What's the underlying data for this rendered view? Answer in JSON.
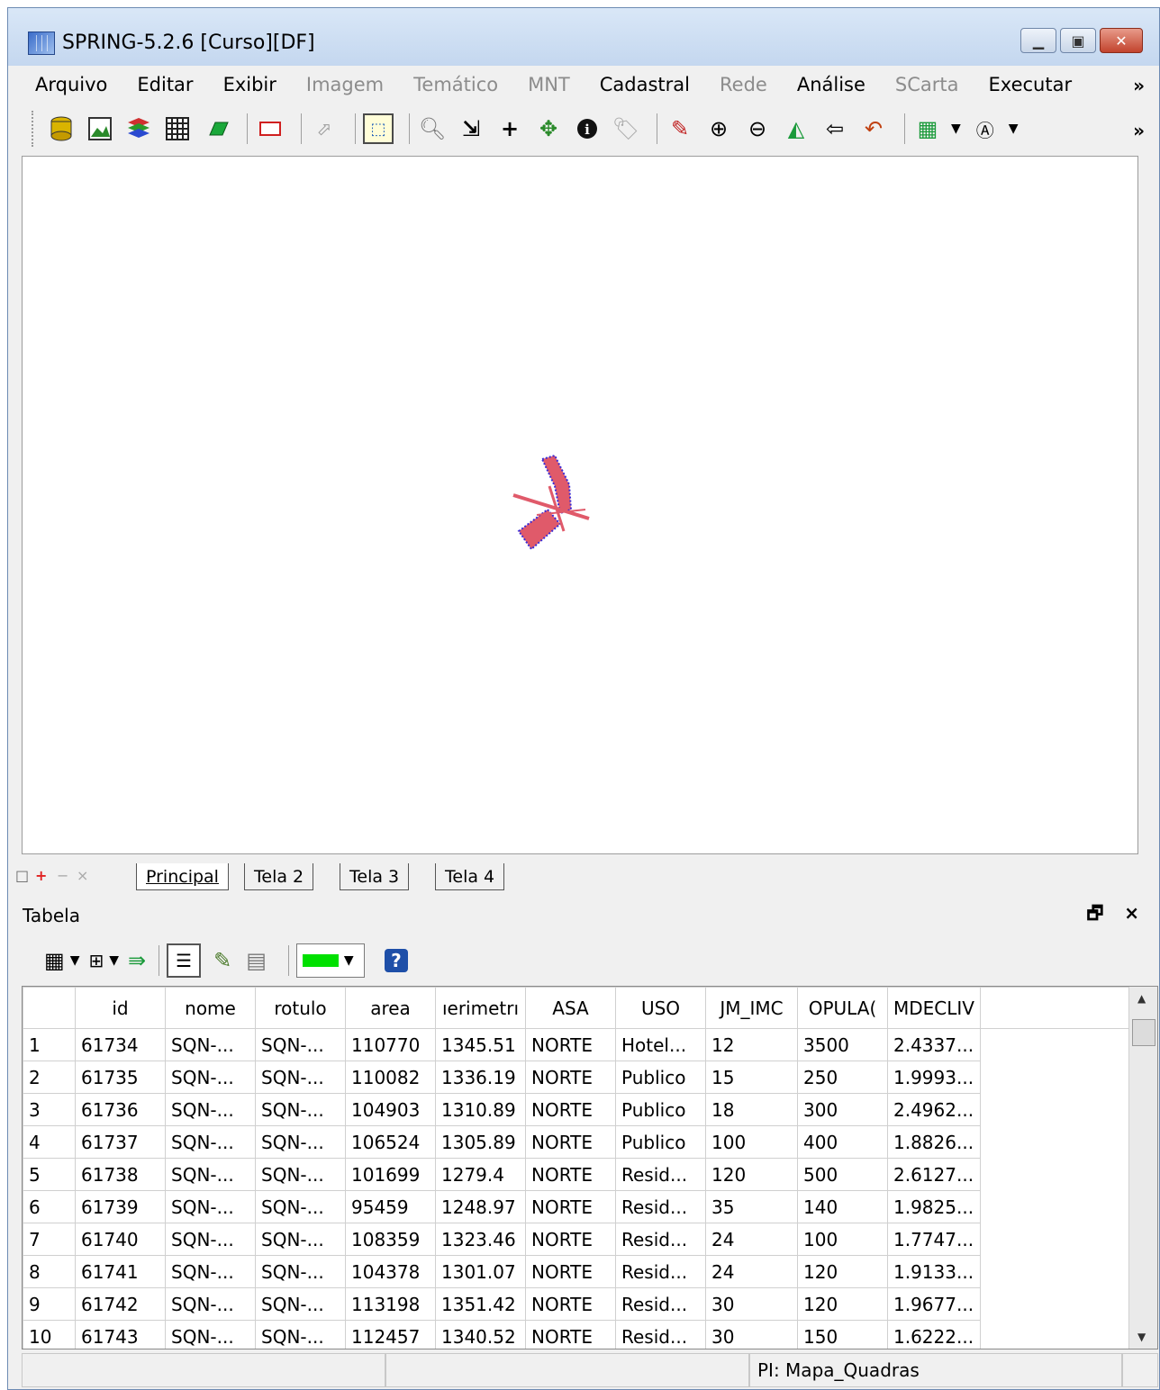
{
  "window": {
    "title": "SPRING-5.2.6 [Curso][DF]"
  },
  "menu": {
    "items": [
      {
        "label": "Arquivo",
        "enabled": true
      },
      {
        "label": "Editar",
        "enabled": true
      },
      {
        "label": "Exibir",
        "enabled": true
      },
      {
        "label": "Imagem",
        "enabled": false
      },
      {
        "label": "Temático",
        "enabled": false
      },
      {
        "label": "MNT",
        "enabled": false
      },
      {
        "label": "Cadastral",
        "enabled": true
      },
      {
        "label": "Rede",
        "enabled": false
      },
      {
        "label": "Análise",
        "enabled": true
      },
      {
        "label": "SCarta",
        "enabled": false
      },
      {
        "label": "Executar",
        "enabled": true
      }
    ],
    "more": "»"
  },
  "toolbar": {
    "icons": [
      "database-icon",
      "image-icon",
      "layers-icon",
      "grid-icon",
      "parallelogram-icon",
      "rectangle-icon",
      "pointer-disabled-icon",
      "cursor-tool-icon",
      "search-icon",
      "jump-icon",
      "crosshair-icon",
      "pan-icon",
      "info-icon",
      "tag-icon",
      "pencil-icon",
      "zoom-in-icon",
      "zoom-out-icon",
      "zoom-area-icon",
      "back-icon",
      "undo-icon",
      "legend-icon",
      "label-icon"
    ],
    "more": "»"
  },
  "tabs": {
    "items": [
      "Principal",
      "Tela 2",
      "Tela 3",
      "Tela 4"
    ],
    "active": "Principal"
  },
  "table_panel": {
    "title": "Tabela",
    "header_buttons": "🗗 ×",
    "color_swatch": "#00e000",
    "help_label": "?"
  },
  "table": {
    "columns": [
      "",
      "id",
      "nome",
      "rotulo",
      "area",
      "ıerimetrı",
      "ASA",
      "USO",
      "JM_IMC",
      "OPULA(",
      "ΜDECLIV",
      ""
    ],
    "rows": [
      [
        "1",
        "61734",
        "SQN-...",
        "SQN-...",
        "110770",
        "1345.51",
        "NORTE",
        "Hotel...",
        "12",
        "3500",
        "2.4337..."
      ],
      [
        "2",
        "61735",
        "SQN-...",
        "SQN-...",
        "110082",
        "1336.19",
        "NORTE",
        "Publico",
        "15",
        "250",
        "1.9993..."
      ],
      [
        "3",
        "61736",
        "SQN-...",
        "SQN-...",
        "104903",
        "1310.89",
        "NORTE",
        "Publico",
        "18",
        "300",
        "2.4962..."
      ],
      [
        "4",
        "61737",
        "SQN-...",
        "SQN-...",
        "106524",
        "1305.89",
        "NORTE",
        "Publico",
        "100",
        "400",
        "1.8826..."
      ],
      [
        "5",
        "61738",
        "SQN-...",
        "SQN-...",
        "101699",
        "1279.4",
        "NORTE",
        "Resid...",
        "120",
        "500",
        "2.6127..."
      ],
      [
        "6",
        "61739",
        "SQN-...",
        "SQN-...",
        "95459",
        "1248.97",
        "NORTE",
        "Resid...",
        "35",
        "140",
        "1.9825..."
      ],
      [
        "7",
        "61740",
        "SQN-...",
        "SQN-...",
        "108359",
        "1323.46",
        "NORTE",
        "Resid...",
        "24",
        "100",
        "1.7747..."
      ],
      [
        "8",
        "61741",
        "SQN-...",
        "SQN-...",
        "104378",
        "1301.07",
        "NORTE",
        "Resid...",
        "24",
        "120",
        "1.9133..."
      ],
      [
        "9",
        "61742",
        "SQN-...",
        "SQN-...",
        "113198",
        "1351.42",
        "NORTE",
        "Resid...",
        "30",
        "120",
        "1.9677..."
      ],
      [
        "10",
        "61743",
        "SQN-...",
        "SQN-...",
        "112457",
        "1340.52",
        "NORTE",
        "Resid...",
        "30",
        "150",
        "1.6222..."
      ]
    ]
  },
  "status": {
    "pi_label": "PI: Mapa_Quadras"
  },
  "colors": {
    "map_fill": "#e05a6a",
    "map_dots": "#3a2bd6"
  }
}
